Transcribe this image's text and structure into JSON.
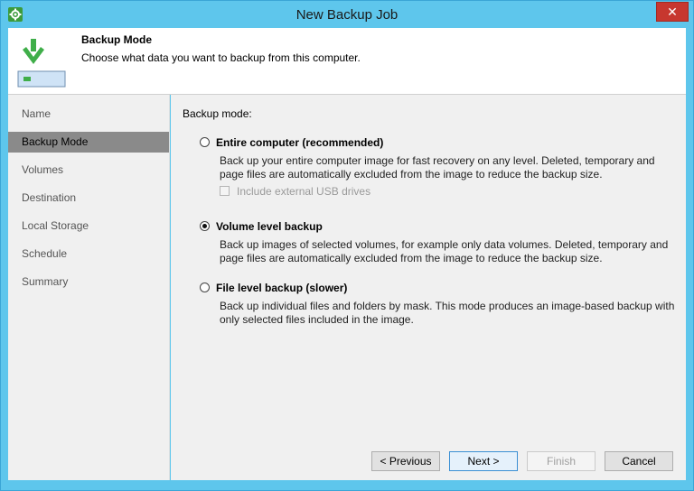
{
  "window": {
    "title": "New Backup Job",
    "close_label": "✕"
  },
  "header": {
    "title": "Backup Mode",
    "subtitle": "Choose what data you want to backup from this computer."
  },
  "nav": {
    "items": [
      {
        "label": "Name",
        "selected": false
      },
      {
        "label": "Backup Mode",
        "selected": true
      },
      {
        "label": "Volumes",
        "selected": false
      },
      {
        "label": "Destination",
        "selected": false
      },
      {
        "label": "Local Storage",
        "selected": false
      },
      {
        "label": "Schedule",
        "selected": false
      },
      {
        "label": "Summary",
        "selected": false
      }
    ]
  },
  "content": {
    "section_label": "Backup mode:",
    "options": [
      {
        "label": "Entire computer (recommended)",
        "selected": false,
        "description_line1": "Back up your entire computer image for fast recovery on any level. Deleted, temporary and",
        "description_line2": "page files are automatically excluded from the image to reduce the backup size."
      },
      {
        "label": "Volume level backup",
        "selected": true,
        "description_line1": "Back up images of selected volumes, for example only data volumes. Deleted, temporary and",
        "description_line2": "page files are automatically excluded from the image to reduce the backup size."
      },
      {
        "label": "File level backup (slower)",
        "selected": false,
        "description_line1": "Back up individual files and folders by mask. This mode produces an image-based backup with",
        "description_line2": "only selected files included in the image."
      }
    ],
    "usb_checkbox": {
      "label": "Include external USB drives",
      "checked": false,
      "enabled": false
    }
  },
  "footer": {
    "previous_label": "< Previous",
    "next_label": "Next >",
    "finish_label": "Finish",
    "cancel_label": "Cancel"
  },
  "icons": {
    "app": "gear-icon",
    "header": "backup-download-icon",
    "close": "close-icon"
  },
  "colors": {
    "titlebar": "#5ec6ec",
    "close_button": "#c7372f",
    "nav_selected": "#8a8a8a",
    "header_arrow": "#3fae49"
  }
}
